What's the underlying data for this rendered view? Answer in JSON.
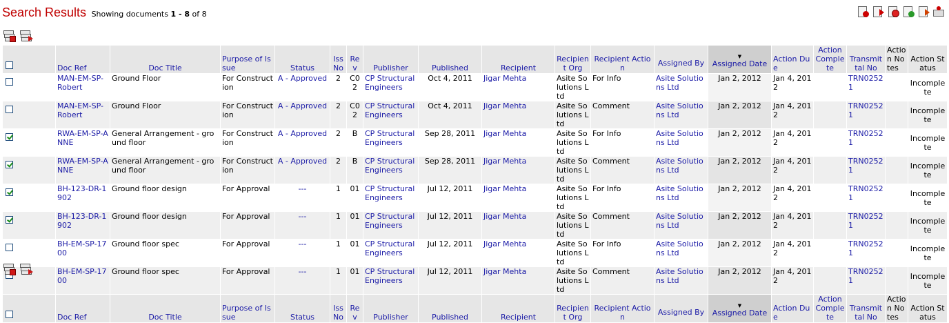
{
  "header": {
    "title": "Search Results",
    "showing_prefix": "Showing documents",
    "range": "1 - 8",
    "of_text": "of 8"
  },
  "toolbar_icons": [
    "remove-icon",
    "export-icon",
    "stop-icon",
    "refresh-icon",
    "download-icon",
    "print-icon"
  ],
  "columns": {
    "select": "",
    "doc_ref": "Doc Ref",
    "doc_title": "Doc Title",
    "purpose": "Purpose of Issue",
    "status": "Status",
    "iss_no": "Iss No",
    "rev": "Rev",
    "publisher": "Publisher",
    "published": "Published",
    "recipient": "Recipient",
    "recipient_org": "Recipient Org",
    "recipient_action": "Recipient Action",
    "assigned_by": "Assigned By",
    "assigned_date": "Assigned Date",
    "action_due": "Action Due",
    "action_complete": "Action Complete",
    "transmittal_no": "Transmittal No",
    "action_notes": "Action Notes",
    "action_status": "Action Status"
  },
  "rows": [
    {
      "checked": false,
      "doc_ref": "MAN-EM-SP-Robert",
      "doc_title": "Ground Floor",
      "purpose": "For Construction",
      "status": "A - Approved",
      "iss_no": "2",
      "rev": "C02",
      "publisher": "CP Structural Engineers",
      "published": "Oct 4, 2011",
      "recipient": "Jigar Mehta",
      "recipient_org": "Asite Solutions Ltd",
      "recipient_action": "For Info",
      "assigned_by": "Asite Solutions Ltd",
      "assigned_date": "Jan 2, 2012",
      "action_due": "Jan 4, 2012",
      "action_complete": "",
      "transmittal_no": "TRN02521",
      "action_notes": "",
      "action_status": "Incomplete"
    },
    {
      "checked": false,
      "doc_ref": "MAN-EM-SP-Robert",
      "doc_title": "Ground Floor",
      "purpose": "For Construction",
      "status": "A - Approved",
      "iss_no": "2",
      "rev": "C02",
      "publisher": "CP Structural Engineers",
      "published": "Oct 4, 2011",
      "recipient": "Jigar Mehta",
      "recipient_org": "Asite Solutions Ltd",
      "recipient_action": "Comment",
      "assigned_by": "Asite Solutions Ltd",
      "assigned_date": "Jan 2, 2012",
      "action_due": "Jan 4, 2012",
      "action_complete": "",
      "transmittal_no": "TRN02521",
      "action_notes": "",
      "action_status": "Incomplete"
    },
    {
      "checked": true,
      "doc_ref": "RWA-EM-SP-ANNE",
      "doc_title": "General Arrangement - ground floor",
      "purpose": "For Construction",
      "status": "A - Approved",
      "iss_no": "2",
      "rev": "B",
      "publisher": "CP Structural Engineers",
      "published": "Sep 28, 2011",
      "recipient": "Jigar Mehta",
      "recipient_org": "Asite Solutions Ltd",
      "recipient_action": "For Info",
      "assigned_by": "Asite Solutions Ltd",
      "assigned_date": "Jan 2, 2012",
      "action_due": "Jan 4, 2012",
      "action_complete": "",
      "transmittal_no": "TRN02521",
      "action_notes": "",
      "action_status": "Incomplete"
    },
    {
      "checked": true,
      "doc_ref": "RWA-EM-SP-ANNE",
      "doc_title": "General Arrangement - ground floor",
      "purpose": "For Construction",
      "status": "A - Approved",
      "iss_no": "2",
      "rev": "B",
      "publisher": "CP Structural Engineers",
      "published": "Sep 28, 2011",
      "recipient": "Jigar Mehta",
      "recipient_org": "Asite Solutions Ltd",
      "recipient_action": "Comment",
      "assigned_by": "Asite Solutions Ltd",
      "assigned_date": "Jan 2, 2012",
      "action_due": "Jan 4, 2012",
      "action_complete": "",
      "transmittal_no": "TRN02521",
      "action_notes": "",
      "action_status": "Incomplete"
    },
    {
      "checked": true,
      "doc_ref": "BH-123-DR-1902",
      "doc_title": "Ground floor design",
      "purpose": "For Approval",
      "status": "---",
      "iss_no": "1",
      "rev": "01",
      "publisher": "CP Structural Engineers",
      "published": "Jul 12, 2011",
      "recipient": "Jigar Mehta",
      "recipient_org": "Asite Solutions Ltd",
      "recipient_action": "For Info",
      "assigned_by": "Asite Solutions Ltd",
      "assigned_date": "Jan 2, 2012",
      "action_due": "Jan 4, 2012",
      "action_complete": "",
      "transmittal_no": "TRN02521",
      "action_notes": "",
      "action_status": "Incomplete"
    },
    {
      "checked": true,
      "doc_ref": "BH-123-DR-1902",
      "doc_title": "Ground floor design",
      "purpose": "For Approval",
      "status": "---",
      "iss_no": "1",
      "rev": "01",
      "publisher": "CP Structural Engineers",
      "published": "Jul 12, 2011",
      "recipient": "Jigar Mehta",
      "recipient_org": "Asite Solutions Ltd",
      "recipient_action": "Comment",
      "assigned_by": "Asite Solutions Ltd",
      "assigned_date": "Jan 2, 2012",
      "action_due": "Jan 4, 2012",
      "action_complete": "",
      "transmittal_no": "TRN02521",
      "action_notes": "",
      "action_status": "Incomplete"
    },
    {
      "checked": false,
      "doc_ref": "BH-EM-SP-1700",
      "doc_title": "Ground floor spec",
      "purpose": "For Approval",
      "status": "---",
      "iss_no": "1",
      "rev": "01",
      "publisher": "CP Structural Engineers",
      "published": "Jul 12, 2011",
      "recipient": "Jigar Mehta",
      "recipient_org": "Asite Solutions Ltd",
      "recipient_action": "For Info",
      "assigned_by": "Asite Solutions Ltd",
      "assigned_date": "Jan 2, 2012",
      "action_due": "Jan 4, 2012",
      "action_complete": "",
      "transmittal_no": "TRN02521",
      "action_notes": "",
      "action_status": "Incomplete"
    },
    {
      "checked": false,
      "doc_ref": "BH-EM-SP-1700",
      "doc_title": "Ground floor spec",
      "purpose": "For Approval",
      "status": "---",
      "iss_no": "1",
      "rev": "01",
      "publisher": "CP Structural Engineers",
      "published": "Jul 12, 2011",
      "recipient": "Jigar Mehta",
      "recipient_org": "Asite Solutions Ltd",
      "recipient_action": "Comment",
      "assigned_by": "Asite Solutions Ltd",
      "assigned_date": "Jan 2, 2012",
      "action_due": "Jan 4, 2012",
      "action_complete": "",
      "transmittal_no": "TRN02521",
      "action_notes": "",
      "action_status": "Incomplete"
    }
  ]
}
